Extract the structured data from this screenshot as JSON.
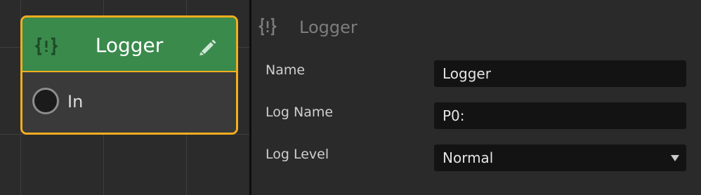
{
  "node": {
    "title": "Logger",
    "type_icon": "braces-icon",
    "edit_icon": "pencil-icon",
    "input_port_label": "In",
    "header_color": "#3a8a4c",
    "selection_color": "#f4ae1e"
  },
  "inspector": {
    "icon": "braces-icon",
    "title": "Logger",
    "fields": {
      "name": {
        "label": "Name",
        "value": "Logger"
      },
      "log_name": {
        "label": "Log Name",
        "value": "P0:"
      },
      "log_level": {
        "label": "Log Level",
        "value": "Normal"
      }
    }
  }
}
